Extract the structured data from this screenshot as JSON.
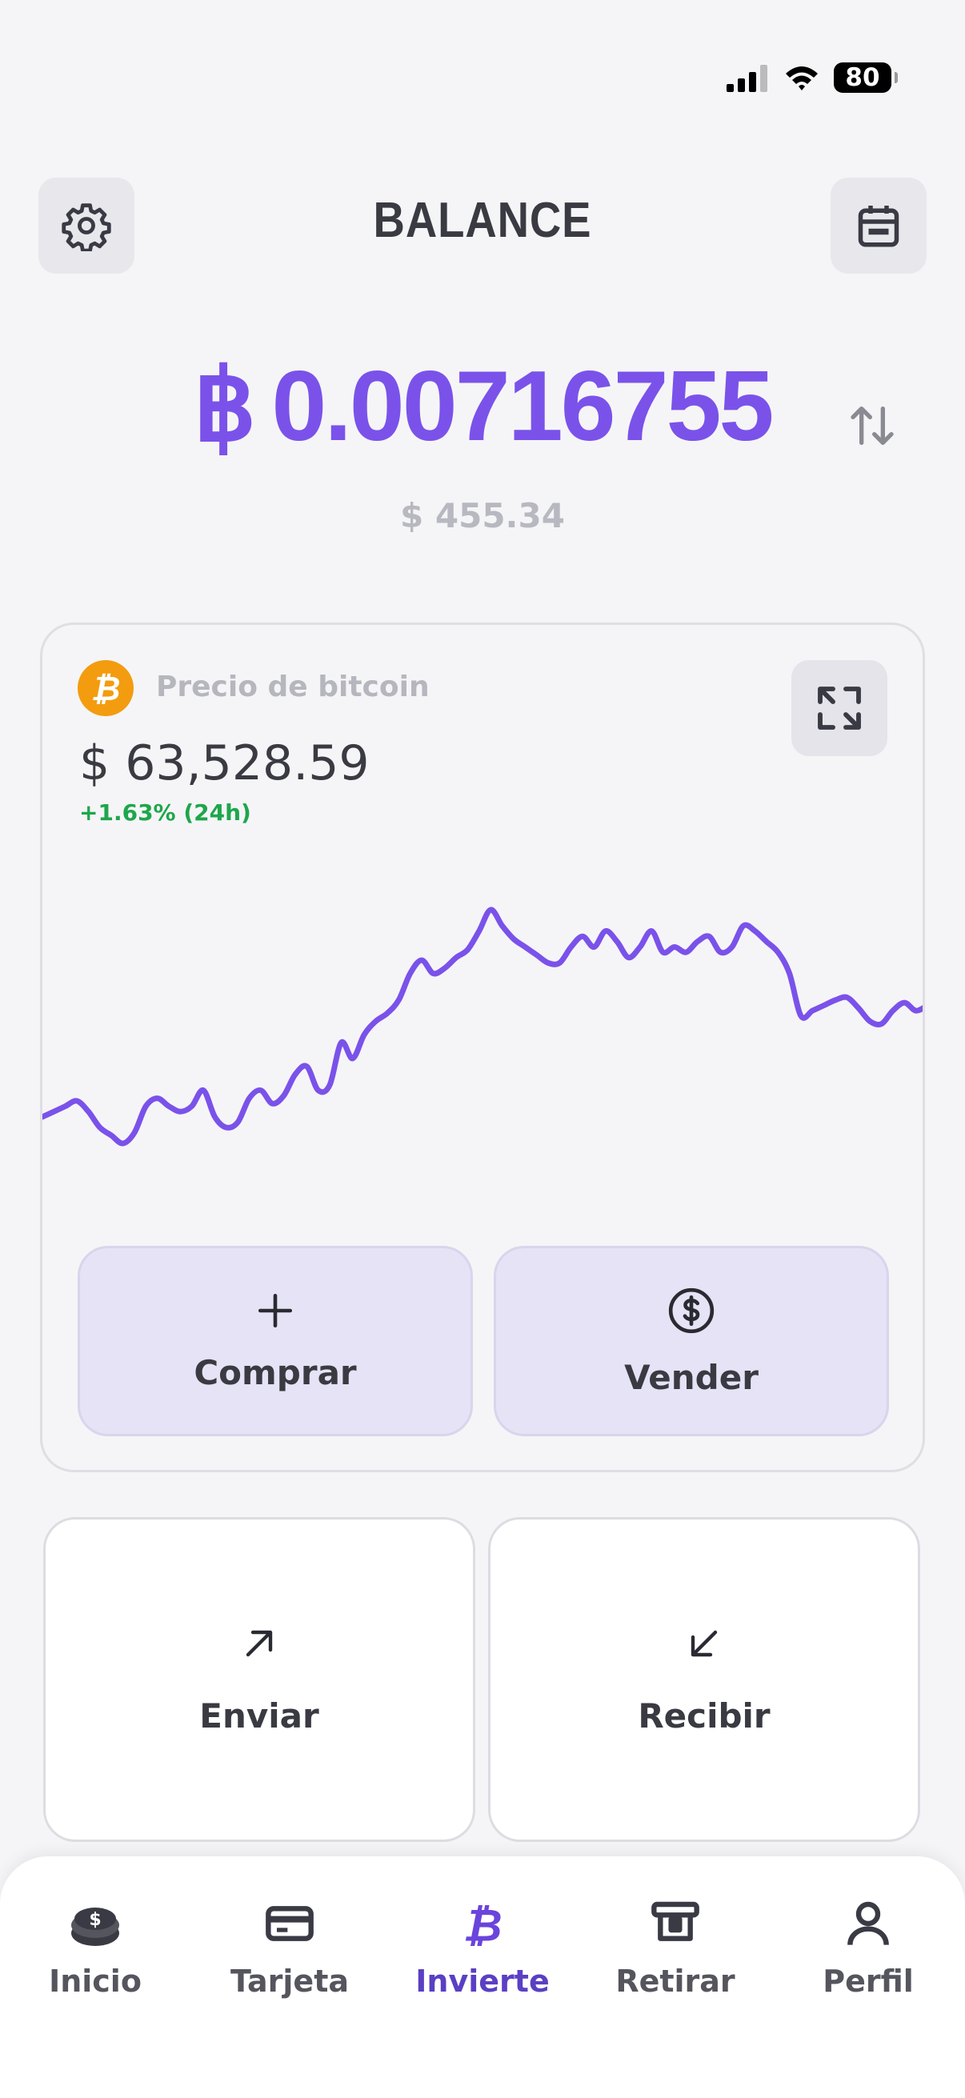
{
  "status_bar": {
    "battery": "80"
  },
  "header": {
    "title": "BALANCE"
  },
  "balance": {
    "currency_symbol": "฿",
    "btc_amount": "0.00716755",
    "usd_amount": "$ 455.34"
  },
  "price_card": {
    "label": "Precio de bitcoin",
    "price": "$ 63,528.59",
    "change": "+1.63% (24h)",
    "badge_symbol": "₿",
    "line_color": "#7a52ea"
  },
  "chart_data": {
    "type": "line",
    "title": "",
    "xlabel": "",
    "ylabel": "",
    "series": [
      {
        "values": [
          61.4,
          61.5,
          61.6,
          61.7,
          61.5,
          61.2,
          61.05,
          60.9,
          61.1,
          61.6,
          61.75,
          61.6,
          61.5,
          61.6,
          61.9,
          61.4,
          61.2,
          61.3,
          61.75,
          61.9,
          61.65,
          61.8,
          62.2,
          62.35,
          61.9,
          62.0,
          62.8,
          62.5,
          62.95,
          63.2,
          63.35,
          63.6,
          64.1,
          64.35,
          64.1,
          64.2,
          64.4,
          64.55,
          64.9,
          65.3,
          65.0,
          64.75,
          64.6,
          64.45,
          64.3,
          64.3,
          64.6,
          64.8,
          64.6,
          64.9,
          64.7,
          64.4,
          64.6,
          64.9,
          64.5,
          64.6,
          64.5,
          64.7,
          64.8,
          64.5,
          64.6,
          65.0,
          64.9,
          64.7,
          64.5,
          64.1,
          63.3,
          63.4,
          63.5,
          63.6,
          63.65,
          63.45,
          63.2,
          63.15,
          63.4,
          63.55,
          63.4,
          63.5
        ]
      }
    ],
    "grid": false,
    "legend": "none"
  },
  "actions": {
    "buy": "Comprar",
    "sell": "Vender",
    "send": "Enviar",
    "receive": "Recibir"
  },
  "tabs": [
    {
      "label": "Inicio",
      "icon": "coins-icon"
    },
    {
      "label": "Tarjeta",
      "icon": "card-icon"
    },
    {
      "label": "Invierte",
      "icon": "bitcoin-icon"
    },
    {
      "label": "Retirar",
      "icon": "atm-icon"
    },
    {
      "label": "Perfil",
      "icon": "person-icon"
    }
  ],
  "active_tab": "Invierte"
}
